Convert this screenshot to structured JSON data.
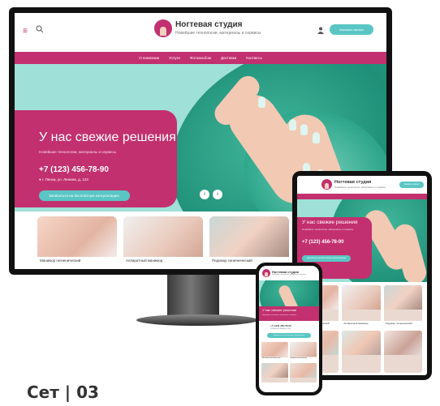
{
  "brand": {
    "name": "Ногтевая студия",
    "tagline": "Новейшие технологии, материалы и сервисы"
  },
  "header": {
    "cta_label": "Заказать звонок"
  },
  "nav": {
    "items": [
      "О компании",
      "Услуги",
      "Фотоальбом",
      "Доставка",
      "Контакты"
    ]
  },
  "hero": {
    "title": "У нас свежие решения",
    "subtitle": "Новейшие технологии, материалы и сервисы",
    "phone": "+7 (123) 456-78-90",
    "address": "г. Пенза, ул. Ленина, д. 123",
    "button_label": "Записаться на бесплатную консультацию",
    "arrow_prev": "‹",
    "arrow_next": "›"
  },
  "services": [
    {
      "label": "Маникюр гигиенический"
    },
    {
      "label": "Аппаратный маникюр"
    },
    {
      "label": "Педикюр гигиенический"
    }
  ],
  "caption": "Сет | 03",
  "colors": {
    "brand": "#c2306f",
    "accent": "#59c6c4",
    "hero_bg": "#9fe0d8"
  }
}
